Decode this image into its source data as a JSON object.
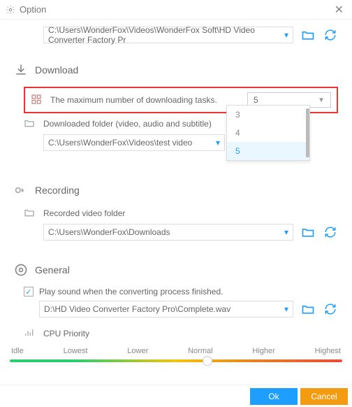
{
  "window": {
    "title": "Option"
  },
  "topPath": {
    "value": "C:\\Users\\WonderFox\\Videos\\WonderFox Soft\\HD Video Converter Factory Pr"
  },
  "download": {
    "heading": "Download",
    "maxTasksLabel": "The maximum number of downloading tasks.",
    "maxTasksValue": "5",
    "dropdownOptions": [
      "3",
      "4",
      "5"
    ],
    "folderLabel": "Downloaded folder (video, audio and subtitle)",
    "folderPath": "C:\\Users\\WonderFox\\Videos\\test video"
  },
  "recording": {
    "heading": "Recording",
    "folderLabel": "Recorded video folder",
    "folderPath": "C:\\Users\\WonderFox\\Downloads"
  },
  "general": {
    "heading": "General",
    "playSoundLabel": "Play sound when the converting process finished.",
    "playSoundChecked": true,
    "soundPath": "D:\\HD Video Converter Factory Pro\\Complete.wav",
    "cpuPriorityLabel": "CPU Priority",
    "sliderLabels": [
      "Idle",
      "Lowest",
      "Lower",
      "Normal",
      "Higher",
      "Highest"
    ]
  },
  "footer": {
    "ok": "Ok",
    "cancel": "Cancel"
  }
}
